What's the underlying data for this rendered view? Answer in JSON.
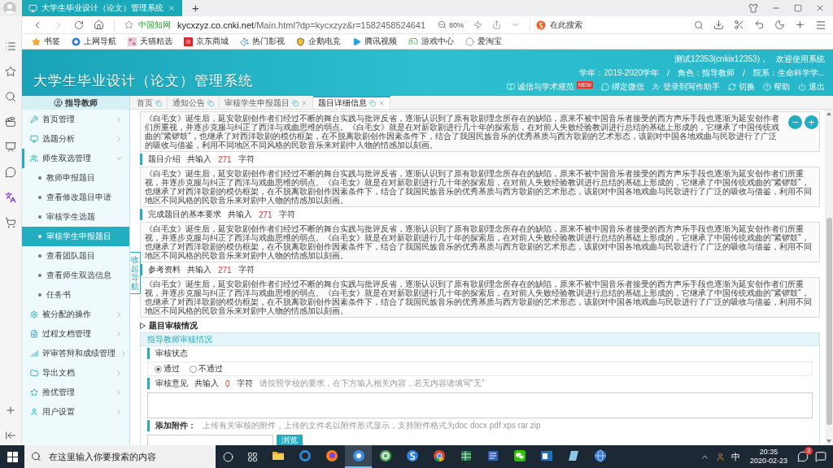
{
  "browser": {
    "tab_title": "大学生毕业设计（论文）管理系统",
    "new_tab": "+",
    "site_label": "中国知网",
    "url_host": "kycxzyz.co.cnki.net",
    "url_path": "/Main.html?dp=kycxzyz&r=1582458524641",
    "zoom": "80%",
    "search_placeholder": "在此搜索",
    "bookmarks": [
      "书签",
      "上网导航",
      "天猫精选",
      "京东商城",
      "热门影视",
      "企鹅电竞",
      "腾讯视频",
      "游戏中心",
      "爱淘宝"
    ]
  },
  "header": {
    "title": "大学生毕业设计（论文）管理系统",
    "welcome": "测试12353(cnkix12353)，",
    "greeting": "欢迎使用系统",
    "info": [
      "学年：2019-2020学年",
      "角色：指导教师",
      "院系：生命科学学..."
    ],
    "separators": [
      "/",
      "/"
    ],
    "links": [
      {
        "label": "诚信与学术规范",
        "badge": "NEW"
      },
      {
        "label": "绑定微信"
      },
      {
        "label": "登录到写作助手"
      },
      {
        "label": "切换"
      },
      {
        "label": "帮助"
      },
      {
        "label": "退出"
      }
    ]
  },
  "sidebar": {
    "role": "指导教师",
    "items": [
      {
        "label": "首页管理",
        "expanded": false
      },
      {
        "label": "选题分析",
        "expanded": false
      },
      {
        "label": "师生双选管理",
        "expanded": true,
        "children": [
          {
            "label": "教师申报题目",
            "selected": false
          },
          {
            "label": "查看修改题目申请",
            "selected": false
          },
          {
            "label": "审核学生选题",
            "selected": false
          },
          {
            "label": "审核学生申报题目",
            "selected": true
          },
          {
            "label": "查看团队题目",
            "selected": false
          },
          {
            "label": "查看师生双选信息",
            "selected": false
          },
          {
            "label": "任务书",
            "selected": false
          }
        ]
      },
      {
        "label": "被分配的操作",
        "expanded": false
      },
      {
        "label": "过程文档管理",
        "expanded": false
      },
      {
        "label": "评审答辩和成绩管理",
        "expanded": false
      },
      {
        "label": "导出文档",
        "expanded": false
      },
      {
        "label": "推优管理",
        "expanded": false
      },
      {
        "label": "用户设置",
        "expanded": false
      }
    ],
    "collapse_tab": "收起导航"
  },
  "tabs": [
    {
      "label": "首页",
      "closable": false,
      "selected": false
    },
    {
      "label": "通知公告",
      "closable": false,
      "selected": false
    },
    {
      "label": "审核学生申报题目",
      "closable": true,
      "selected": false
    },
    {
      "label": "题目详细信息",
      "closable": true,
      "selected": true
    }
  ],
  "float_buttons": [
    "−",
    "+"
  ],
  "detail": {
    "sections": [
      {
        "text": "《白毛女》诞生后，延安歌剧创作者们经过不断的舞台实践与批评反省，逐渐认识到了原有歌剧理念所存在的缺陷，原来不被中国音乐者接受的西方声乐手段也逐渐为延安创作者们所重视，并逐步克服与纠正了西洋与戏曲思维的弱点。《白毛女》就是在对新歌剧进行几十年的探索后，在对前人失败经验教训进行总结的基础上形成的，它继承了中国传统戏曲的“紧锣鼓”，也继承了对西洋歌剧的模仿框架，在不脱离歌剧创作因素条件下，结合了我国民族音乐的优秀基质与西方歌剧的艺术形态，该剧对中国各地戏曲与民歌进行了广泛的吸收与借鉴，利用不同地区不同风格的民歌音乐来对剧中人物的情感加以刻画。"
      },
      {
        "title": "题目介绍",
        "count_label": "共输入",
        "count": "271",
        "unit": "字符",
        "text": "《白毛女》诞生后，延安歌剧创作者们经过不断的舞台实践与批评反省，逐渐认识到了原有歌剧理念所存在的缺陷，原来不被中国音乐者接受的西方声乐手段也逐渐为延安创作者们所重视，并逐步克服与纠正了西洋与戏曲思维的弱点。《白毛女》就是在对新歌剧进行几十年的探索后，在对前人失败经验教训进行总结的基础上形成的，它继承了中国传统戏曲的“紧锣鼓”，也继承了对西洋歌剧的模仿框架，在不脱离歌剧创作因素条件下，结合了我国民族音乐的优秀基质与西方歌剧的艺术形态，该剧对中国各地戏曲与民歌进行了广泛的吸收与借鉴，利用不同地区不同风格的民歌音乐来对剧中人物的情感加以刻画。"
      },
      {
        "title": "完成题目的基本要求",
        "count_label": "共输入",
        "count": "271",
        "unit": "字符",
        "text": "《白毛女》诞生后，延安歌剧创作者们经过不断的舞台实践与批评反省，逐渐认识到了原有歌剧理念所存在的缺陷，原来不被中国音乐者接受的西方声乐手段也逐渐为延安创作者们所重视，并逐步克服与纠正了西洋与戏曲思维的弱点。《白毛女》就是在对新歌剧进行几十年的探索后，在对前人失败经验教训进行总结的基础上形成的，它继承了中国传统戏曲的“紧锣鼓”，也继承了对西洋歌剧的模仿框架，在不脱离歌剧创作因素条件下，结合了我国民族音乐的优秀基质与西方歌剧的艺术形态，该剧对中国各地戏曲与民歌进行了广泛的吸收与借鉴，利用不同地区不同风格的民歌音乐来对剧中人物的情感加以刻画。"
      },
      {
        "title": "参考资料",
        "count_label": "共输入",
        "count": "271",
        "unit": "字符",
        "text": "《白毛女》诞生后，延安歌剧创作者们经过不断的舞台实践与批评反省，逐渐认识到了原有歌剧理念所存在的缺陷，原来不被中国音乐者接受的西方声乐手段也逐渐为延安创作者们所重视，并逐步克服与纠正了西洋与戏曲思维的弱点。《白毛女》就是在对新歌剧进行几十年的探索后，在对前人失败经验教训进行总结的基础上形成的，它继承了中国传统戏曲的“紧锣鼓”，也继承了对西洋歌剧的模仿框架，在不脱离歌剧创作因素条件下，结合了我国民族音乐的优秀基质与西方歌剧的艺术形态，该剧对中国各地戏曲与民歌进行了广泛的吸收与借鉴，利用不同地区不同风格的民歌音乐来对剧中人物的情感加以刻画。"
      }
    ]
  },
  "review": {
    "title": "题目审核情况",
    "panel_title": "指导教师审核情况",
    "status_label": "审核状态",
    "options": [
      {
        "label": "通过",
        "selected": true
      },
      {
        "label": "不通过",
        "selected": false
      }
    ],
    "opinion": {
      "title": "审核意见",
      "count_label": "共输入",
      "count": "0",
      "unit": "字符",
      "hint": "请按照学校的要求，在下方输入相关内容，若无内容请填写“无”"
    },
    "attachment": {
      "label": "添加附件：",
      "hint": "上传有关审核的附件，上传的文件名以附件形式显示，支持附件格式为doc docx pdf xps rar zip",
      "button": "浏览"
    }
  },
  "taskbar": {
    "search_placeholder": "在这里输入你要搜索的内容",
    "apps": [
      {
        "selected": false
      },
      {
        "selected": false
      },
      {
        "selected": false
      },
      {
        "selected": true
      },
      {
        "selected": false
      },
      {
        "selected": false
      },
      {
        "selected": false
      },
      {
        "selected": false
      },
      {
        "selected": false
      },
      {
        "selected": false
      },
      {
        "selected": false
      },
      {
        "selected": false
      },
      {
        "selected": false
      }
    ],
    "ime": "中",
    "time": "20:35",
    "date": "2020-02-23",
    "notifications": "3"
  }
}
